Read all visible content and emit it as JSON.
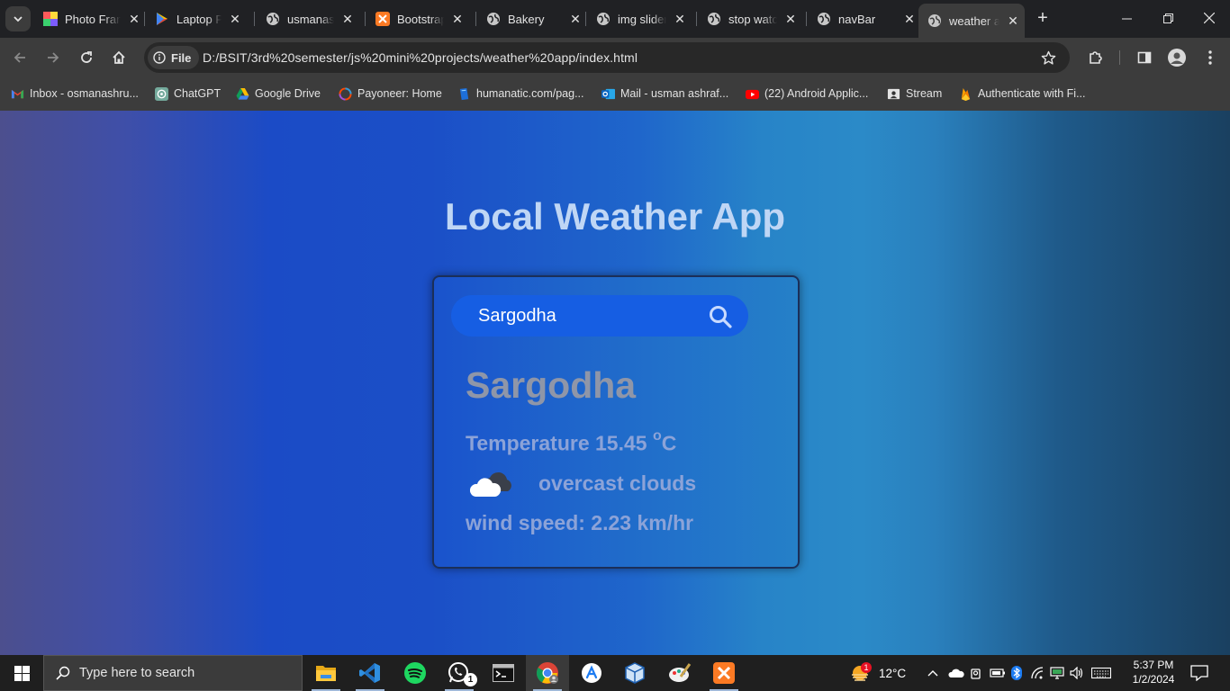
{
  "browser": {
    "tabs": [
      {
        "title": "Photo Frame",
        "icon": "photo-frame-icon"
      },
      {
        "title": "Laptop Price",
        "icon": "play-store-icon"
      },
      {
        "title": "usmanashraf",
        "icon": "globe-icon"
      },
      {
        "title": "Bootstrap",
        "icon": "xampp-icon"
      },
      {
        "title": "Bakery",
        "icon": "globe-icon"
      },
      {
        "title": "img slider",
        "icon": "globe-icon"
      },
      {
        "title": "stop watch",
        "icon": "globe-icon"
      },
      {
        "title": "navBar",
        "icon": "globe-icon"
      },
      {
        "title": "weather app",
        "icon": "globe-icon",
        "active": true
      }
    ],
    "omnibox": {
      "chip_label": "File",
      "url": "D:/BSIT/3rd%20semester/js%20mini%20projects/weather%20app/index.html"
    },
    "bookmarks": [
      {
        "label": "Inbox - osmanashru...",
        "icon": "gmail-icon"
      },
      {
        "label": "ChatGPT",
        "icon": "chatgpt-icon"
      },
      {
        "label": "Google Drive",
        "icon": "google-drive-icon"
      },
      {
        "label": "Payoneer: Home",
        "icon": "payoneer-icon"
      },
      {
        "label": "humanatic.com/pag...",
        "icon": "humanatic-icon"
      },
      {
        "label": "Mail - usman ashraf...",
        "icon": "outlook-icon"
      },
      {
        "label": "(22) Android Applic...",
        "icon": "youtube-icon"
      },
      {
        "label": "Stream",
        "icon": "stream-icon"
      },
      {
        "label": "Authenticate with Fi...",
        "icon": "firebase-icon"
      }
    ]
  },
  "app": {
    "title": "Local Weather App",
    "search": {
      "value": "Sargodha",
      "placeholder": ""
    },
    "city": "Sargodha",
    "temperature_label": "Temperature 15.45 ",
    "temperature_unit_deg": "o",
    "temperature_unit": "C",
    "description": "overcast clouds",
    "wind": "wind speed: 2.23 km/hr",
    "colors": {
      "title": "#bfd6f5",
      "city": "#8f96a8",
      "details": "#8ca3d8",
      "search_bg": "#165ee3"
    }
  },
  "taskbar": {
    "search_placeholder": "Type here to search",
    "apps": [
      "file-explorer-icon",
      "vscode-icon",
      "spotify-icon",
      "whatsapp-icon",
      "terminal-icon",
      "chrome-icon",
      "app-store-icon",
      "virtualbox-icon",
      "paint-icon",
      "xampp-icon"
    ],
    "whatsapp_badge": "1",
    "weather_badge": "1",
    "temperature": "12°C",
    "time": "5:37 PM",
    "date": "1/2/2024"
  }
}
